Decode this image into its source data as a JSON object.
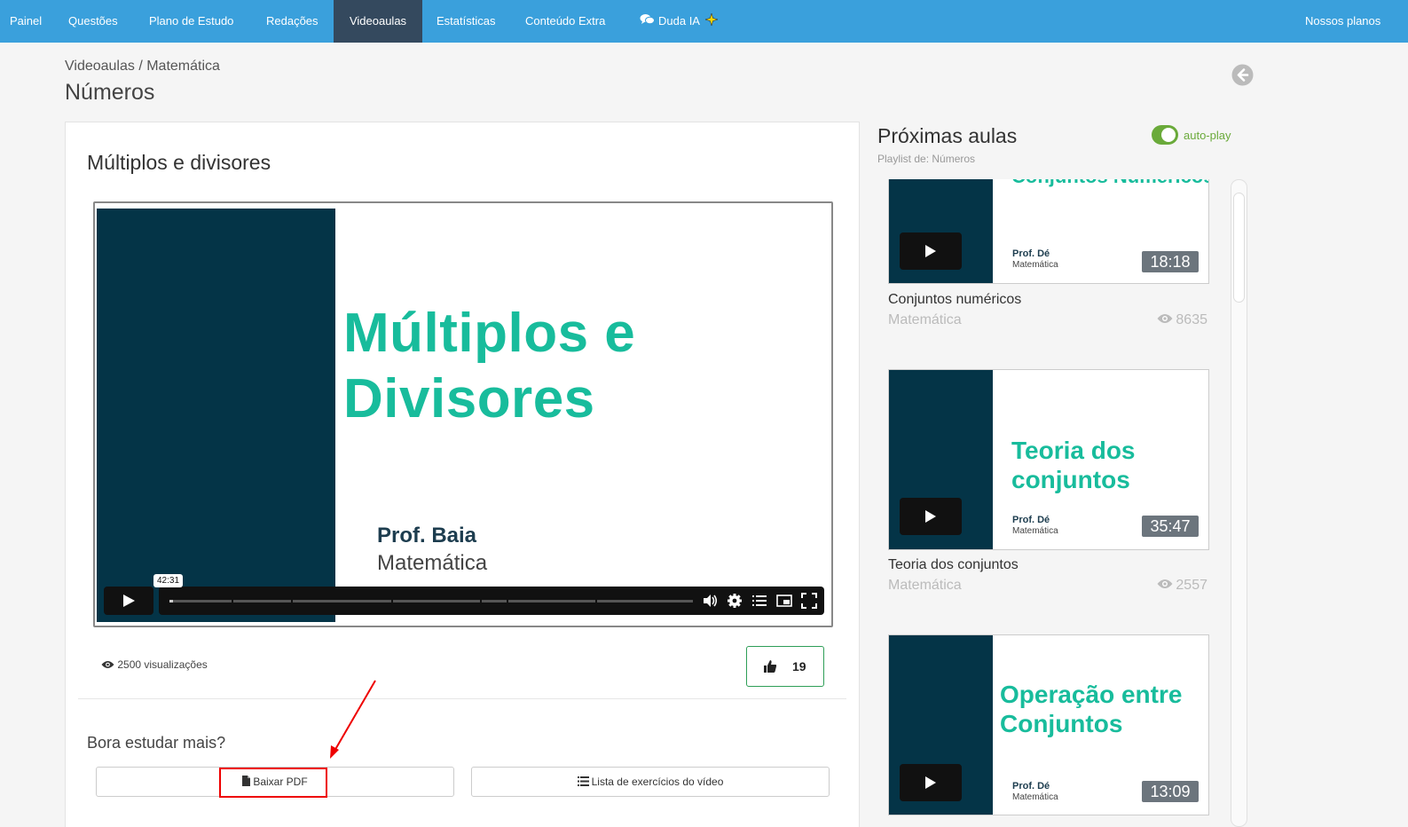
{
  "nav": {
    "items": [
      {
        "label": "Painel"
      },
      {
        "label": "Questões"
      },
      {
        "label": "Plano de Estudo"
      },
      {
        "label": "Redações"
      },
      {
        "label": "Videoaulas"
      },
      {
        "label": "Estatísticas"
      },
      {
        "label": "Conteúdo Extra"
      },
      {
        "label": "Duda IA"
      }
    ],
    "active": "Videoaulas",
    "right_link": "Nossos planos"
  },
  "breadcrumb": "Videoaulas / Matemática",
  "page_title": "Números",
  "lesson": {
    "title": "Múltiplos e divisores",
    "slide_title_line1": "Múltiplos e",
    "slide_title_line2": "Divisores",
    "slide_prof": "Prof. Baia",
    "slide_subject": "Matemática",
    "time_tooltip": "42:31",
    "views": "2500 visualizações",
    "likes": "19"
  },
  "more": {
    "heading": "Bora estudar mais?",
    "pdf_button": "Baixar PDF",
    "exercises_button": "Lista de exercícios do vídeo"
  },
  "sidebar": {
    "title": "Próximas aulas",
    "subtitle": "Playlist de: Números",
    "autoplay_label": "auto-play",
    "autoplay_on": true,
    "items": [
      {
        "thumb_title_1": "Conjuntos Numéricos",
        "thumb_title_2": "",
        "prof": "Prof. Dé",
        "thumb_subject": "Matemática",
        "duration": "18:18",
        "name": "Conjuntos numéricos",
        "subject": "Matemática",
        "views": "8635"
      },
      {
        "thumb_title_1": "Teoria dos",
        "thumb_title_2": "conjuntos",
        "prof": "Prof. Dé",
        "thumb_subject": "Matemática",
        "duration": "35:47",
        "name": "Teoria dos conjuntos",
        "subject": "Matemática",
        "views": "2557"
      },
      {
        "thumb_title_1": "Operação entre",
        "thumb_title_2": "Conjuntos",
        "prof": "Prof. Dé",
        "thumb_subject": "Matemática",
        "duration": "13:09",
        "name": "",
        "subject": "",
        "views": ""
      }
    ]
  },
  "colors": {
    "nav_bg": "#3aa0dc",
    "nav_active": "#34495e",
    "slide_dark": "#043447",
    "slide_accent": "#18bc9c",
    "like_border": "#2e9e57",
    "toggle_on": "#6aaa3a",
    "highlight": "#e00000"
  }
}
